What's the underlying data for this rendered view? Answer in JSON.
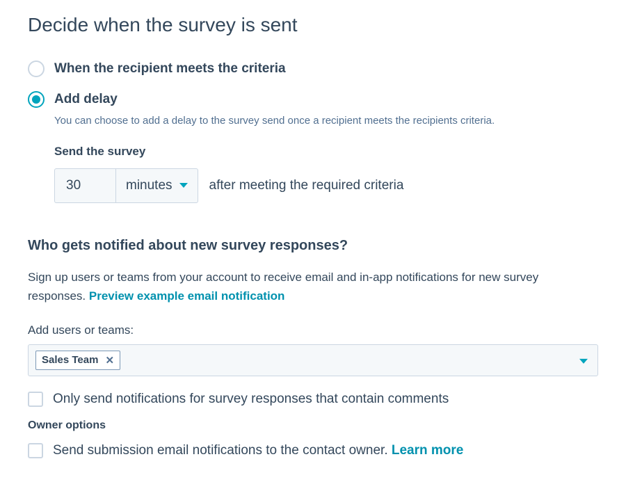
{
  "title": "Decide when the survey is sent",
  "timing": {
    "option_immediate": "When the recipient meets the criteria",
    "option_delay": "Add delay",
    "delay_description": "You can choose to add a delay to the survey send once a recipient meets the recipients criteria.",
    "send_label": "Send the survey",
    "delay_value": "30",
    "delay_unit": "minutes",
    "after_label": "after meeting the required criteria"
  },
  "notifications": {
    "heading": "Who gets notified about new survey responses?",
    "description_part1": "Sign up users or teams from your account to receive email and in-app notifications for new survey responses. ",
    "preview_link": "Preview example email notification",
    "add_label": "Add users or teams:",
    "selected_tags": [
      {
        "label": "Sales Team"
      }
    ],
    "only_comments_label": "Only send notifications for survey responses that contain comments",
    "owner_heading": "Owner options",
    "owner_check_label": "Send submission email notifications to the contact owner. ",
    "owner_learn_more": "Learn more"
  }
}
